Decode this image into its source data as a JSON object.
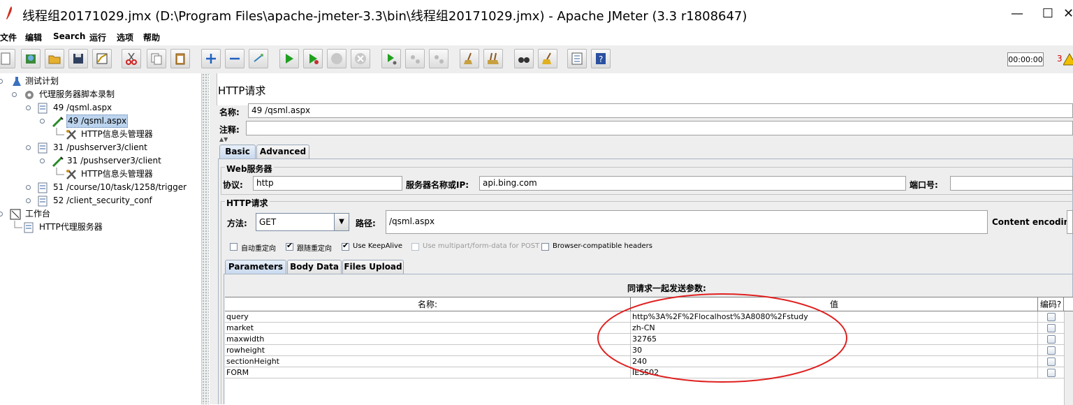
{
  "window": {
    "title": "线程组20171029.jmx (D:\\Program Files\\apache-jmeter-3.3\\bin\\线程组20171029.jmx) - Apache JMeter (3.3 r1808647)",
    "minimize": "—",
    "maximize": "☐",
    "close": "✕"
  },
  "menu": [
    "文件",
    "编辑",
    "Search",
    "运行",
    "选项",
    "帮助"
  ],
  "toolbar": {
    "timer": "00:00:00",
    "error_count": "3"
  },
  "tree": [
    {
      "label": "测试计划",
      "icon": "flask-icon"
    },
    {
      "label": "代理服务器脚本录制",
      "icon": "gear-icon"
    },
    {
      "label": "49 /qsml.aspx",
      "icon": "sampler-icon"
    },
    {
      "label": "49 /qsml.aspx",
      "icon": "pipette-icon",
      "selected": true
    },
    {
      "label": "HTTP信息头管理器",
      "icon": "tools-icon"
    },
    {
      "label": "31 /pushserver3/client",
      "icon": "sampler-icon"
    },
    {
      "label": "31 /pushserver3/client",
      "icon": "pipette-icon"
    },
    {
      "label": "HTTP信息头管理器",
      "icon": "tools-icon"
    },
    {
      "label": "51 /course/10/task/1258/trigger",
      "icon": "sampler-icon"
    },
    {
      "label": "52 /client_security_conf",
      "icon": "sampler-icon"
    },
    {
      "label": "工作台",
      "icon": "workbench-icon"
    },
    {
      "label": "HTTP代理服务器",
      "icon": "sampler-icon"
    }
  ],
  "panel": {
    "title": "HTTP请求",
    "name_label": "名称:",
    "name_value": "49 /qsml.aspx",
    "comment_label": "注释:",
    "comment_value": "",
    "tabs": [
      "Basic",
      "Advanced"
    ],
    "web_server": {
      "group_label": "Web服务器",
      "protocol_label": "协议:",
      "protocol_value": "http",
      "server_label": "服务器名称或IP:",
      "server_value": "api.bing.com",
      "port_label": "端口号:",
      "port_value": ""
    },
    "http_request": {
      "group_label": "HTTP请求",
      "method_label": "方法:",
      "method_value": "GET",
      "path_label": "路径:",
      "path_value": "/qsml.aspx",
      "encoding_label": "Content encoding:"
    },
    "options": [
      {
        "label": "自动重定向",
        "checked": false
      },
      {
        "label": "跟随重定向",
        "checked": true
      },
      {
        "label": "Use KeepAlive",
        "checked": true
      },
      {
        "label": "Use multipart/form-data for POST",
        "checked": false
      },
      {
        "label": "Browser-compatible headers",
        "checked": false
      }
    ],
    "check_mark": "✔",
    "sub_tabs": [
      "Parameters",
      "Body Data",
      "Files Upload"
    ],
    "params_title": "同请求一起发送参数:",
    "columns": [
      "名称:",
      "值",
      "编码?"
    ],
    "rows": [
      {
        "name": "query",
        "value": "http%3A%2F%2Flocalhost%3A8080%2Fstudy"
      },
      {
        "name": "market",
        "value": "zh-CN"
      },
      {
        "name": "maxwidth",
        "value": "32765"
      },
      {
        "name": "rowheight",
        "value": "30"
      },
      {
        "name": "sectionHeight",
        "value": "240"
      },
      {
        "name": "FORM",
        "value": "IESS02"
      }
    ]
  },
  "colors": {
    "annotation": "#e02020",
    "selection": "#bcd4ee"
  }
}
